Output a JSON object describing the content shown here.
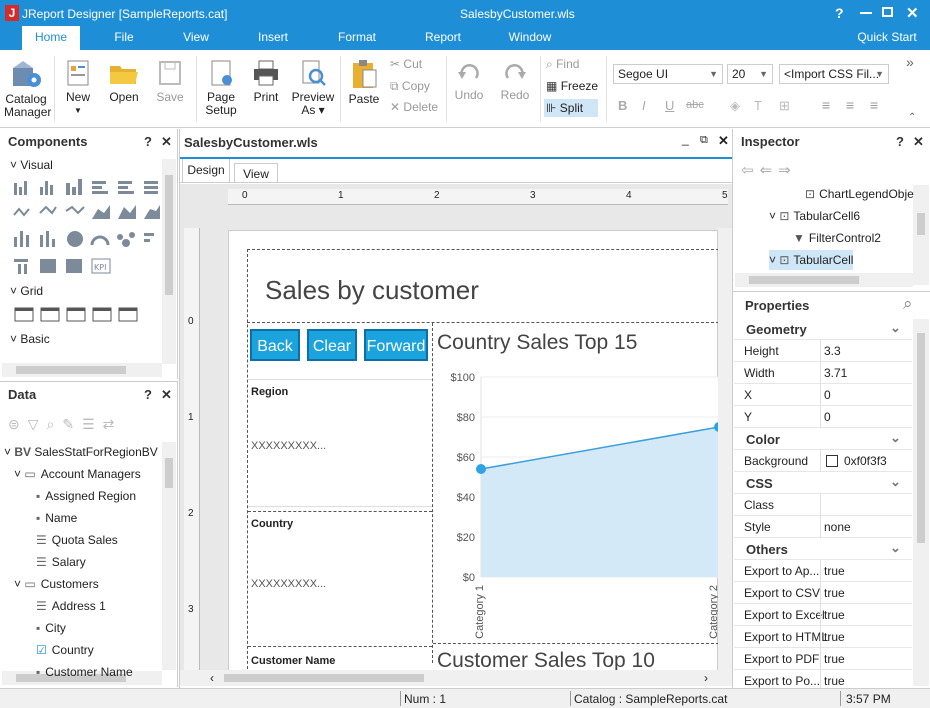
{
  "app": {
    "title": "JReport Designer [SampleReports.cat]",
    "document_title": "SalesbyCustomer.wls",
    "window_buttons": [
      "?",
      "—",
      "□",
      "✕"
    ]
  },
  "menu": {
    "tabs": [
      "Home",
      "File",
      "View",
      "Insert",
      "Format",
      "Report",
      "Window"
    ],
    "quick_start": "Quick Start"
  },
  "ribbon": {
    "catalog_manager": "Catalog\nManager",
    "new": "New",
    "open": "Open",
    "save": "Save",
    "page_setup": "Page\nSetup",
    "print": "Print",
    "preview_as": "Preview\nAs ▾",
    "paste": "Paste",
    "cut": "Cut",
    "copy": "Copy",
    "delete": "Delete",
    "undo": "Undo",
    "redo": "Redo",
    "find": "Find",
    "freeze": "Freeze",
    "split": "Split",
    "font": "Segoe UI",
    "font_size": "20",
    "css_file": "<Import CSS Fil..."
  },
  "components": {
    "title": "Components",
    "visual": "Visual",
    "grid": "Grid",
    "basic": "Basic"
  },
  "data_panel": {
    "title": "Data",
    "bv": "BV",
    "root": "SalesStatForRegionBV",
    "items": [
      {
        "label": "Account Managers",
        "level": 1,
        "kind": "folder"
      },
      {
        "label": "Assigned Region",
        "level": 2,
        "kind": "field"
      },
      {
        "label": "Name",
        "level": 2,
        "kind": "field"
      },
      {
        "label": "Quota Sales",
        "level": 2,
        "kind": "list"
      },
      {
        "label": "Salary",
        "level": 2,
        "kind": "list"
      },
      {
        "label": "Customers",
        "level": 1,
        "kind": "folder"
      },
      {
        "label": "Address 1",
        "level": 2,
        "kind": "list"
      },
      {
        "label": "City",
        "level": 2,
        "kind": "field"
      },
      {
        "label": "Country",
        "level": 2,
        "kind": "checked"
      },
      {
        "label": "Customer Name",
        "level": 2,
        "kind": "field"
      }
    ]
  },
  "document": {
    "tab": "SalesbyCustomer.wls",
    "subtabs": [
      "Design",
      "View"
    ],
    "ruler": [
      "0",
      "1",
      "2",
      "3",
      "4",
      "5"
    ],
    "vruler": [
      "0",
      "1",
      "2",
      "3"
    ],
    "report_title": "Sales by customer",
    "buttons": [
      "Back",
      "Clear",
      "Forward"
    ],
    "region_label": "Region",
    "region_value": "XXXXXXXXX...",
    "country_label": "Country",
    "country_value": "XXXXXXXXX...",
    "customer_name_label": "Customer Name",
    "chart2_title": "Customer Sales Top 10"
  },
  "chart_data": {
    "type": "area",
    "title": "Country Sales Top 15",
    "categories": [
      "Category 1",
      "Category 2"
    ],
    "values": [
      54,
      75
    ],
    "ylim": [
      0,
      100
    ],
    "yticks": [
      "$0",
      "$20",
      "$40",
      "$60",
      "$80",
      "$100"
    ],
    "color": "#3a9fdc"
  },
  "inspector": {
    "title": "Inspector",
    "tree": [
      {
        "label": "ChartLegendObje",
        "level": 3
      },
      {
        "label": "TabularCell6",
        "level": 2
      },
      {
        "label": "FilterControl2",
        "level": 3
      },
      {
        "label": "TabularCell",
        "level": 2
      }
    ],
    "properties_title": "Properties",
    "sections": {
      "geometry": "Geometry",
      "color": "Color",
      "css": "CSS",
      "others": "Others"
    },
    "geometry": [
      {
        "key": "Height",
        "value": "3.3"
      },
      {
        "key": "Width",
        "value": "3.71"
      },
      {
        "key": "X",
        "value": "0"
      },
      {
        "key": "Y",
        "value": "0"
      }
    ],
    "color": [
      {
        "key": "Background",
        "value": "0xf0f3f3"
      }
    ],
    "css": [
      {
        "key": "Class",
        "value": ""
      },
      {
        "key": "Style",
        "value": "none"
      }
    ],
    "others": [
      {
        "key": "Export to Ap...",
        "value": "true"
      },
      {
        "key": "Export to CSV",
        "value": "true"
      },
      {
        "key": "Export to Excel",
        "value": "true"
      },
      {
        "key": "Export to HTML",
        "value": "true"
      },
      {
        "key": "Export to PDF",
        "value": "true"
      },
      {
        "key": "Export to Po...",
        "value": "true"
      }
    ]
  },
  "status": {
    "num": "Num : 1",
    "catalog": "Catalog : SampleReports.cat",
    "time": "3:57 PM"
  }
}
